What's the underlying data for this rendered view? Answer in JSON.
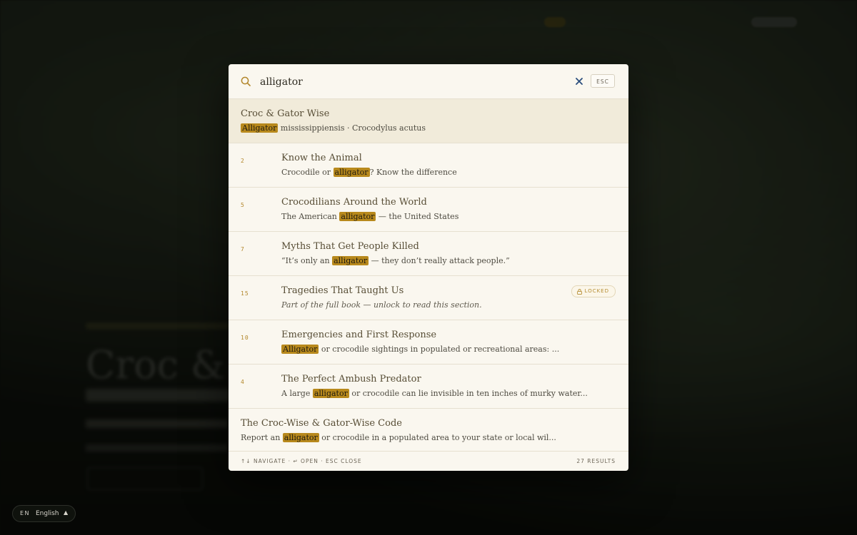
{
  "search": {
    "query": "alligator",
    "esc_label": "ESC"
  },
  "results": [
    {
      "number": "",
      "title": "Croc & Gator Wise",
      "snippet_before": "",
      "highlight": "Alligator",
      "snippet_after": " mississippiensis · Crocodylus acutus"
    },
    {
      "number": "2",
      "title": "Know the Animal",
      "snippet_before": "Crocodile or ",
      "highlight": "alligator",
      "snippet_after": "? Know the difference"
    },
    {
      "number": "5",
      "title": "Crocodilians Around the World",
      "snippet_before": "The American ",
      "highlight": "alligator",
      "snippet_after": " — the United States"
    },
    {
      "number": "7",
      "title": "Myths That Get People Killed",
      "snippet_before": "“It’s only an ",
      "highlight": "alligator",
      "snippet_after": " — they don’t really attack people.”"
    },
    {
      "number": "15",
      "title": "Tragedies That Taught Us",
      "snippet": "Part of the full book — unlock to read this section.",
      "badge": "LOCKED"
    },
    {
      "number": "10",
      "title": "Emergencies and First Response",
      "snippet_before": "",
      "highlight": "Alligator",
      "snippet_after": " or crocodile sightings in populated or recreational areas: ..."
    },
    {
      "number": "4",
      "title": "The Perfect Ambush Predator",
      "snippet_before": "A large ",
      "highlight": "alligator",
      "snippet_after": " or crocodile can lie invisible in ten inches of murky water..."
    },
    {
      "number": "",
      "title": "The Croc-Wise & Gator-Wise Code",
      "snippet_before": "Report an ",
      "highlight": "alligator",
      "snippet_after": " or crocodile in a populated area to your state or local wil..."
    }
  ],
  "footer": {
    "hints": "↑↓ NAVIGATE · ↵ OPEN · ESC CLOSE",
    "count": "27 RESULTS"
  },
  "language": {
    "code": "EN",
    "name": "English",
    "caret": "▲"
  },
  "colors": {
    "accent": "#b8891c",
    "modal_bg": "#faf7ef",
    "active_row": "#f1ebda",
    "clear_icon": "#2a4d7c"
  },
  "icons": {
    "search": "search-icon",
    "clear": "close-icon",
    "lock": "lock-icon"
  }
}
